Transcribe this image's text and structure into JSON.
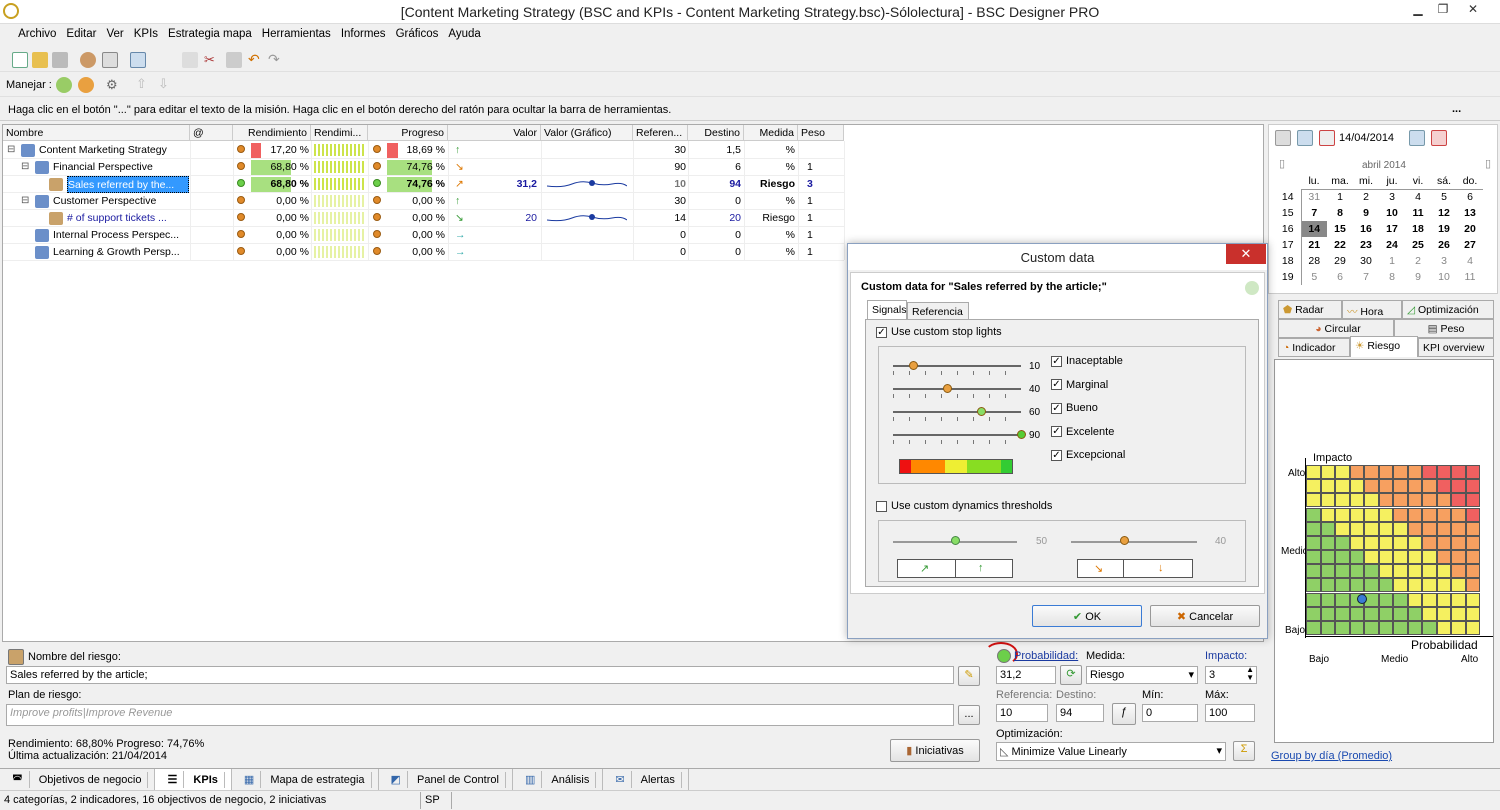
{
  "window": {
    "title": "[Content Marketing Strategy (BSC and KPIs - Content Marketing Strategy.bsc)-Sólolectura] - BSC Designer PRO"
  },
  "menu": [
    "Archivo",
    "Editar",
    "Ver",
    "KPIs",
    "Estrategia mapa",
    "Herramientas",
    "Informes",
    "Gráficos",
    "Ayuda"
  ],
  "manage_label": "Manejar :",
  "hint": "Haga clic en el botón \"...\" para editar el texto de la misión. Haga clic en el botón derecho del ratón para ocultar la barra de herramientas.",
  "hint_btn": "...",
  "grid": {
    "headers": [
      "Nombre",
      "@",
      "Rendimiento",
      "Rendimi...",
      "Progreso",
      "Valor",
      "Valor (Gráfico)",
      "Referen...",
      "Destino",
      "Medida",
      "Peso"
    ],
    "rows": [
      {
        "name": "Content Marketing Strategy",
        "perf": "17,20 %",
        "prog": "18,69 %",
        "valor": "",
        "ref": "30",
        "dest": "1,5",
        "med": "%",
        "peso": "",
        "perf_frac": 0.172,
        "prog_frac": 0.187
      },
      {
        "name": "Financial Perspective",
        "perf": "68,80 %",
        "prog": "74,76 %",
        "valor": "",
        "ref": "90",
        "dest": "6",
        "med": "%",
        "peso": "1",
        "perf_frac": 0.688,
        "prog_frac": 0.748
      },
      {
        "name": "Sales referred by the...",
        "perf": "68,80 %",
        "prog": "74,76 %",
        "valor": "31,2",
        "ref": "10",
        "dest": "94",
        "med": "Riesgo",
        "peso": "3",
        "perf_frac": 0.688,
        "prog_frac": 0.748
      },
      {
        "name": "Customer Perspective",
        "perf": "0,00 %",
        "prog": "0,00 %",
        "valor": "",
        "ref": "30",
        "dest": "0",
        "med": "%",
        "peso": "1",
        "perf_frac": 0,
        "prog_frac": 0
      },
      {
        "name": "# of support tickets ...",
        "perf": "0,00 %",
        "prog": "0,00 %",
        "valor": "20",
        "ref": "14",
        "dest": "20",
        "med": "Riesgo",
        "peso": "1",
        "perf_frac": 0,
        "prog_frac": 0
      },
      {
        "name": "Internal Process Perspec...",
        "perf": "0,00 %",
        "prog": "0,00 %",
        "valor": "",
        "ref": "0",
        "dest": "0",
        "med": "%",
        "peso": "1",
        "perf_frac": 0,
        "prog_frac": 0
      },
      {
        "name": "Learning & Growth Persp...",
        "perf": "0,00 %",
        "prog": "0,00 %",
        "valor": "",
        "ref": "0",
        "dest": "0",
        "med": "%",
        "peso": "1",
        "perf_frac": 0,
        "prog_frac": 0
      }
    ]
  },
  "calendar": {
    "date": "14/04/2014",
    "month": "abril 2014",
    "dows": [
      "lu.",
      "ma.",
      "mi.",
      "ju.",
      "vi.",
      "sá.",
      "do."
    ],
    "weeks": [
      {
        "wk": "14",
        "d": [
          "31",
          "1",
          "2",
          "3",
          "4",
          "5",
          "6"
        ]
      },
      {
        "wk": "15",
        "d": [
          "7",
          "8",
          "9",
          "10",
          "11",
          "12",
          "13"
        ]
      },
      {
        "wk": "16",
        "d": [
          "14",
          "15",
          "16",
          "17",
          "18",
          "19",
          "20"
        ]
      },
      {
        "wk": "17",
        "d": [
          "21",
          "22",
          "23",
          "24",
          "25",
          "26",
          "27"
        ]
      },
      {
        "wk": "18",
        "d": [
          "28",
          "29",
          "30",
          "1",
          "2",
          "3",
          "4"
        ]
      },
      {
        "wk": "19",
        "d": [
          "5",
          "6",
          "7",
          "8",
          "9",
          "10",
          "11"
        ]
      }
    ]
  },
  "chart_tabs": [
    "Radar",
    "Hora",
    "Optimización",
    "Circular",
    "Peso",
    "Indicador",
    "Riesgo",
    "KPI overview"
  ],
  "risk": {
    "y_label": "Impacto",
    "x_label": "Probabilidad",
    "y_ticks": [
      "Alto",
      "Medio",
      "Bajo"
    ],
    "x_ticks": [
      "Bajo",
      "Medio",
      "Alto"
    ]
  },
  "group_link": "Group by día (Promedio)",
  "dialog": {
    "title": "Custom data",
    "heading": "Custom data for \"Sales referred by the article;\"",
    "tabs": [
      "Signals",
      "Referencia"
    ],
    "use_stop": "Use custom stop lights",
    "sliders": [
      {
        "v": "10",
        "label": "Inaceptable"
      },
      {
        "v": "40",
        "label": "Marginal"
      },
      {
        "v": "60",
        "label": "Bueno"
      },
      {
        "v": "90",
        "label": "Excelente"
      },
      {
        "v": "",
        "label": "Excepcional"
      }
    ],
    "use_dyn": "Use custom dynamics thresholds",
    "dyn_vals": [
      "50",
      "40"
    ],
    "ok": "OK",
    "cancel": "Cancelar"
  },
  "bottom": {
    "risk_name_label": "Nombre del riesgo:",
    "risk_name": "Sales referred by the article;",
    "plan_label": "Plan de riesgo:",
    "plan_placeholder": "Improve profits|Improve Revenue",
    "perf_line": "Rendimiento: 68,80% Progreso: 74,76%",
    "update_line": "Última actualización: 21/04/2014",
    "init_btn": "Iniciativas",
    "prob_label": "Probabilidad:",
    "prob": "31,2",
    "medida_label": "Medida:",
    "medida": "Riesgo",
    "impacto_label": "Impacto:",
    "impacto": "3",
    "ref_label": "Referencia:",
    "ref": "10",
    "dest_label": "Destino:",
    "dest": "94",
    "min_label": "Mín:",
    "min": "0",
    "max_label": "Máx:",
    "max": "100",
    "opt_label": "Optimización:",
    "opt": "Minimize Value Linearly"
  },
  "bottom_tabs": [
    "Objetivos de negocio",
    "KPIs",
    "Mapa de estrategia",
    "Panel de Control",
    "Análisis",
    "Alertas"
  ],
  "status": {
    "text": "4 categorías, 2 indicadores, 16 objectivos de negocio, 2 iniciativas",
    "mode": "SP"
  }
}
